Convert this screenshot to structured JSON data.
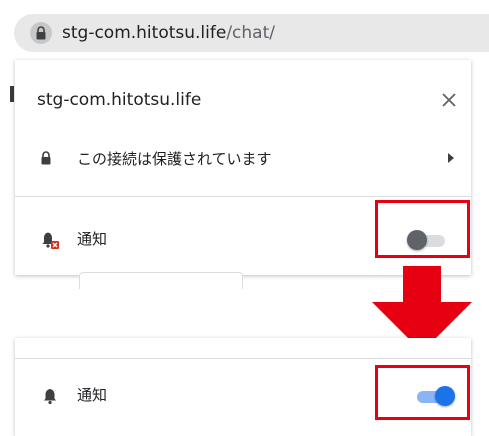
{
  "address_bar": {
    "host": "stg-com.hitotsu.life",
    "path": "/chat/",
    "icon": "lock-icon"
  },
  "site_info": {
    "site_name": "stg-com.hitotsu.life",
    "close_icon": "close-icon",
    "connection_text": "この接続は保護されています",
    "connection_icon": "lock-icon",
    "connection_arrow_icon": "chevron-right-icon",
    "notification": {
      "label": "通知",
      "icon": "notifications-blocked-icon",
      "enabled": false
    }
  },
  "after": {
    "notification": {
      "label": "通知",
      "icon": "bell-icon",
      "enabled": true
    }
  },
  "arrow": {
    "direction": "down",
    "icon": "arrow-down-icon"
  },
  "colors": {
    "highlight": "#e60012",
    "toggle_on": "#1a73e8",
    "toggle_off": "#5f6368"
  }
}
